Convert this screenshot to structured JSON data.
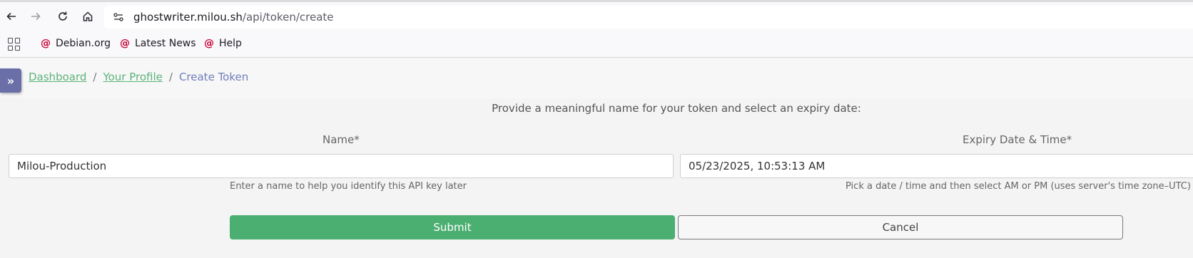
{
  "browser": {
    "url_host": "ghostwriter.milou.sh",
    "url_path": "/api/token/create",
    "bookmarks": [
      {
        "label": "Debian.org"
      },
      {
        "label": "Latest News"
      },
      {
        "label": "Help"
      }
    ]
  },
  "breadcrumb": {
    "items": [
      "Dashboard",
      "Your Profile"
    ],
    "separator": "/",
    "current": "Create Token"
  },
  "form": {
    "instruction": "Provide a meaningful name for your token and select an expiry date:",
    "name": {
      "label": "Name*",
      "value": "Milou-Production",
      "help": "Enter a name to help you identify this API key later"
    },
    "expiry": {
      "label": "Expiry Date & Time*",
      "value": "05/23/2025, 10:53:13 AM",
      "help": "Pick a date / time and then select AM or PM (uses server's time zone–UTC)"
    },
    "submit_label": "Submit",
    "cancel_label": "Cancel"
  },
  "colors": {
    "accent_green": "#4caf72",
    "sidebar_toggle": "#6a6fa8",
    "breadcrumb_current": "#6f7fba",
    "debian_red": "#c70036"
  },
  "icons": {
    "back": "arrow-left-icon",
    "forward": "arrow-right-icon",
    "reload": "reload-icon",
    "home": "home-icon",
    "site_info": "site-info-icon",
    "apps": "apps-grid-icon",
    "bookmark": "debian-swirl-icon",
    "sidebar": "double-chevron-right-icon"
  }
}
